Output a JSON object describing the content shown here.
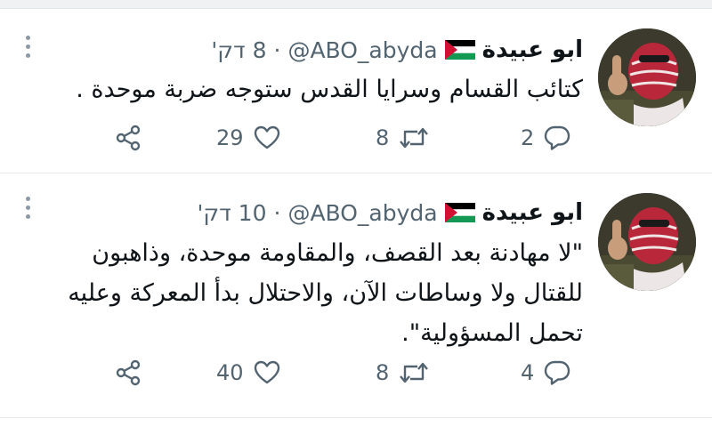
{
  "tweets": [
    {
      "author": "ابو عبيدة",
      "handle": "@ABO_abyda",
      "separator": "·",
      "time": "8 דק'",
      "text": "كتائب القسام وسرايا القدس ستوجه ضربة موحدة .",
      "replies": "2",
      "retweets": "8",
      "likes": "29"
    },
    {
      "author": "ابو عبيدة",
      "handle": "@ABO_abyda",
      "separator": "·",
      "time": "10 דק'",
      "text": "\"لا مهادنة بعد القصف، والمقاومة موحدة، وذاهبون للقتال ولا وساطات الآن، والاحتلال بدأ المعركة وعليه تحمل المسؤولية\".",
      "replies": "4",
      "retweets": "8",
      "likes": "40"
    }
  ],
  "colors": {
    "text": "#0f1419",
    "secondary": "#536471",
    "divider": "#e6e9eb",
    "flag_red": "#d21034",
    "flag_green": "#149954"
  },
  "icons": [
    "avatar-photo",
    "palestine-flag-icon",
    "more-options-icon",
    "reply-icon",
    "retweet-icon",
    "like-icon",
    "share-icon"
  ]
}
